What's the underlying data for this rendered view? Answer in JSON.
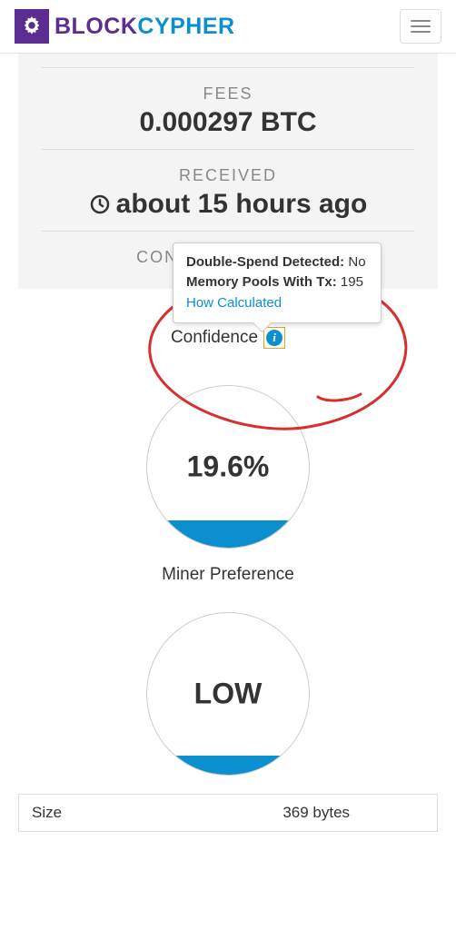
{
  "nav": {
    "logo_block": "BLOCK",
    "logo_cypher": "CYPHER"
  },
  "stats": {
    "fees_label": "FEES",
    "fees_value": "0.000297 BTC",
    "received_label": "RECEIVED",
    "received_value": "about 15 hours ago",
    "confirmations_label": "CONFIRMATIONS"
  },
  "confidence": {
    "label": "Confidence",
    "tooltip": {
      "double_spend_key": "Double-Spend Detected:",
      "double_spend_val": "No",
      "mempool_key": "Memory Pools With Tx:",
      "mempool_val": "195",
      "link": "How Calculated"
    }
  },
  "gauges": {
    "confidence_value": "19.6%",
    "miner_pref_label": "Miner Preference",
    "miner_pref_value": "LOW"
  },
  "table": {
    "size_key": "Size",
    "size_val": "369 bytes"
  }
}
